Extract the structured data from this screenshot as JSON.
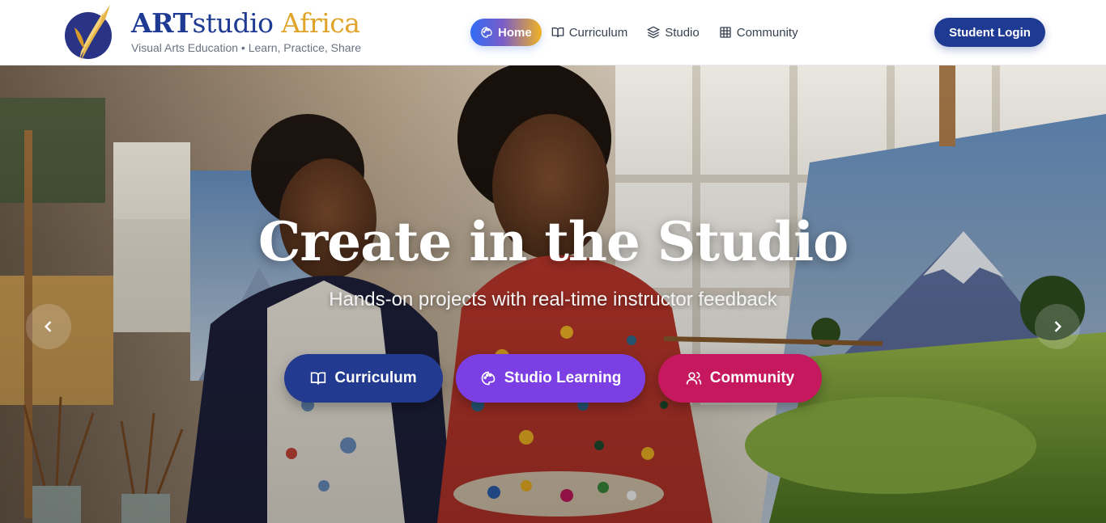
{
  "brand": {
    "title_art": "ART",
    "title_studio": "studio",
    "title_africa": " Africa",
    "tagline": "Visual Arts Education • Learn, Practice, Share"
  },
  "nav": {
    "items": [
      {
        "label": "Home",
        "icon": "palette-icon",
        "active": true
      },
      {
        "label": "Curriculum",
        "icon": "book-open-icon",
        "active": false
      },
      {
        "label": "Studio",
        "icon": "layers-icon",
        "active": false
      },
      {
        "label": "Community",
        "icon": "grid-icon",
        "active": false
      }
    ]
  },
  "header": {
    "login_label": "Student Login"
  },
  "hero": {
    "title": "Create in the Studio",
    "subtitle": "Hands-on projects with real-time instructor feedback",
    "buttons": [
      {
        "label": "Curriculum",
        "icon": "book-open-icon",
        "color": "#223a8f"
      },
      {
        "label": "Studio Learning",
        "icon": "palette-icon",
        "color": "#7b3fe4"
      },
      {
        "label": "Community",
        "icon": "users-icon",
        "color": "#c5185f"
      }
    ],
    "prev_icon": "chevron-left-icon",
    "next_icon": "chevron-right-icon"
  },
  "colors": {
    "brand_navy": "#1f3a93",
    "brand_gold": "#e0a42a",
    "active_nav_gradient": [
      "#2f6cf5",
      "#7a5cc9",
      "#f0b323"
    ]
  }
}
